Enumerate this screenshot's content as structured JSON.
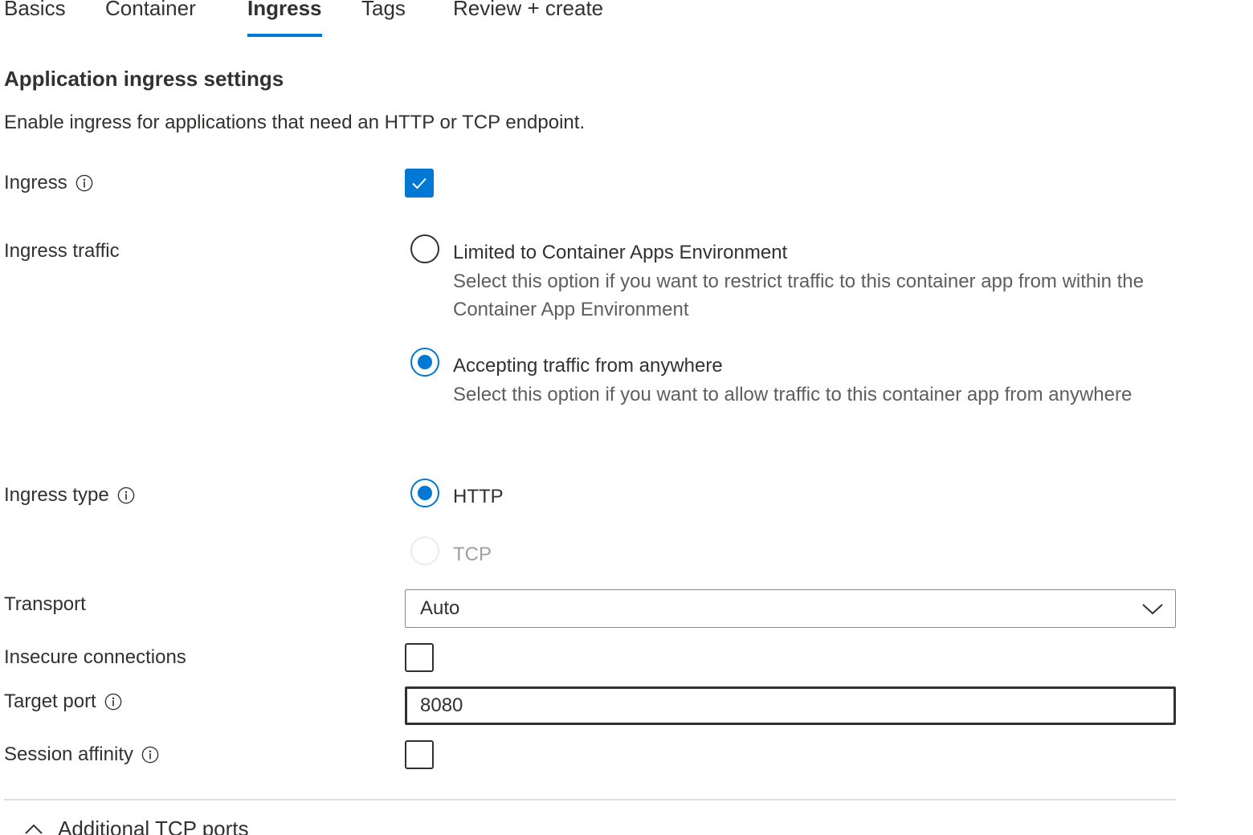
{
  "tabs": [
    {
      "label": "Basics",
      "active": false
    },
    {
      "label": "Container",
      "active": false
    },
    {
      "label": "Ingress",
      "active": true
    },
    {
      "label": "Tags",
      "active": false
    },
    {
      "label": "Review + create",
      "active": false
    }
  ],
  "section": {
    "title": "Application ingress settings",
    "description": "Enable ingress for applications that need an HTTP or TCP endpoint."
  },
  "fields": {
    "ingress": {
      "label": "Ingress",
      "checked": true
    },
    "ingress_traffic": {
      "label": "Ingress traffic",
      "options": [
        {
          "label": "Limited to Container Apps Environment",
          "description": "Select this option if you want to restrict traffic to this container app from within the Container App Environment",
          "selected": false
        },
        {
          "label": "Accepting traffic from anywhere",
          "description": "Select this option if you want to allow traffic to this container app from anywhere",
          "selected": true
        }
      ]
    },
    "ingress_type": {
      "label": "Ingress type",
      "options": [
        {
          "label": "HTTP",
          "selected": true,
          "disabled": false
        },
        {
          "label": "TCP",
          "selected": false,
          "disabled": true
        }
      ]
    },
    "transport": {
      "label": "Transport",
      "value": "Auto"
    },
    "insecure_connections": {
      "label": "Insecure connections",
      "checked": false
    },
    "target_port": {
      "label": "Target port",
      "value": "8080"
    },
    "session_affinity": {
      "label": "Session affinity",
      "checked": false
    }
  },
  "expander": {
    "label": "Additional TCP ports",
    "expanded": true
  },
  "colors": {
    "accent": "#0078d4",
    "text": "#323130",
    "secondary_text": "#605e5c",
    "disabled_text": "#a19f9d"
  }
}
